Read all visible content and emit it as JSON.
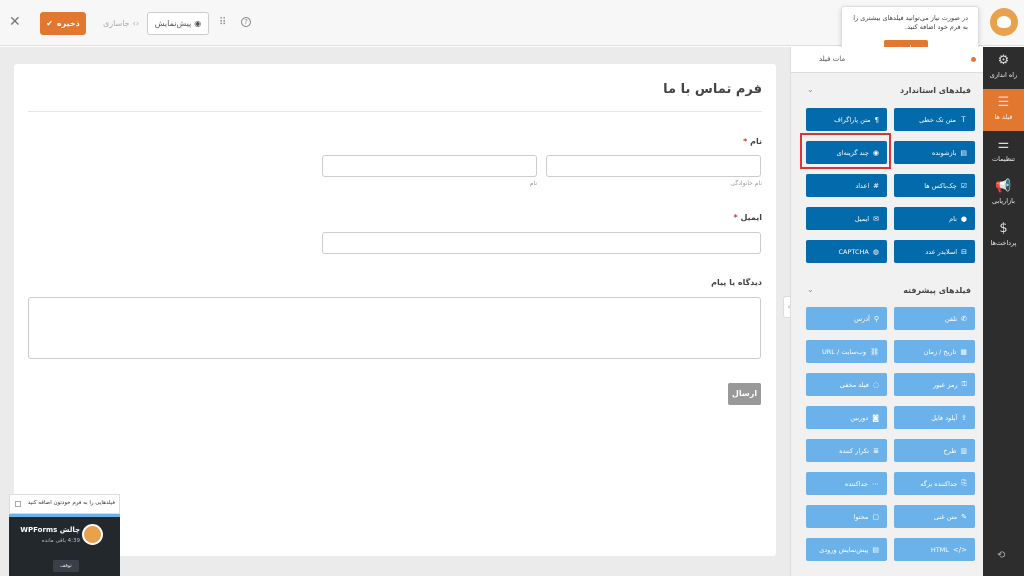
{
  "topbar": {
    "save_label": "ذخیره",
    "embed_label": "جاسازی",
    "preview_label": "پیش‌نمایش",
    "right_text": "در"
  },
  "popup": {
    "text": "در صورت نیاز می‌توانید فیلدهای بیشتری را به فرم خود اضافه کنید.",
    "button": "تمام شد"
  },
  "form": {
    "title": "فرم تماس با ما",
    "name_label": "نام",
    "name_first_sub": "نام خانوادگی",
    "name_last_sub": "نام",
    "email_label": "ایمیل",
    "message_label": "دیدگاه یا پیام",
    "submit_label": "ارسال",
    "required_mark": "*"
  },
  "panel": {
    "tab_label": "مات فیلد",
    "standard_title": "فیلدهای استاندارد",
    "advanced_title": "فیلدهای پیشرفته",
    "standard_fields": [
      {
        "label": "متن تک خطی",
        "icon": "Ｔ"
      },
      {
        "label": "متن پاراگراف",
        "icon": "¶"
      },
      {
        "label": "بازشونده",
        "icon": "▤"
      },
      {
        "label": "چند گزینه‌ای",
        "icon": "◉"
      },
      {
        "label": "چک‌باکس ها",
        "icon": "☑"
      },
      {
        "label": "اعداد",
        "icon": "#"
      },
      {
        "label": "نام",
        "icon": "●"
      },
      {
        "label": "ایمیل",
        "icon": "✉"
      },
      {
        "label": "اسلایدر عدد",
        "icon": "⊟"
      },
      {
        "label": "CAPTCHA",
        "icon": "◍"
      }
    ],
    "advanced_fields": [
      {
        "label": "تلفن",
        "icon": "✆"
      },
      {
        "label": "آدرس",
        "icon": "⚲"
      },
      {
        "label": "تاریخ / زمان",
        "icon": "▦"
      },
      {
        "label": "وب‌سایت / URL",
        "icon": "⛓"
      },
      {
        "label": "رمز عبور",
        "icon": "⚿"
      },
      {
        "label": "فیلد مخفی",
        "icon": "◌"
      },
      {
        "label": "آپلود فایل",
        "icon": "⇪"
      },
      {
        "label": "دوربین",
        "icon": "◙"
      },
      {
        "label": "طرح",
        "icon": "▥"
      },
      {
        "label": "تکرار کننده",
        "icon": "≣"
      },
      {
        "label": "جداکننده برگه",
        "icon": "⎘"
      },
      {
        "label": "جداکننده",
        "icon": "⋯"
      },
      {
        "label": "متن غنی",
        "icon": "✎"
      },
      {
        "label": "محتوا",
        "icon": "▢"
      },
      {
        "label": "HTML",
        "icon": "</>"
      },
      {
        "label": "پیش‌نمایش ورودی",
        "icon": "▤"
      }
    ]
  },
  "sidebar": {
    "items": [
      {
        "label": "راه اندازی",
        "icon": "⚙"
      },
      {
        "label": "فیلد ها",
        "icon": "☰"
      },
      {
        "label": "تنظیمات",
        "icon": "⚌"
      },
      {
        "label": "بازاریابی",
        "icon": "📢"
      },
      {
        "label": "پرداخت‌ها",
        "icon": "$"
      }
    ],
    "help_icon": "⟲"
  },
  "widget": {
    "checkbox_text": "فیلدهایی را به فرم خودتون اضافه کنید",
    "title": "چالش WPForms",
    "sub": "4:39 باقی مانده",
    "button": "توقف"
  },
  "colors": {
    "accent": "#e27730",
    "standard_field": "#036aab",
    "advanced_field": "#6cb2ea",
    "sidebar_bg": "#2d2d2d",
    "highlight": "#d63638"
  }
}
